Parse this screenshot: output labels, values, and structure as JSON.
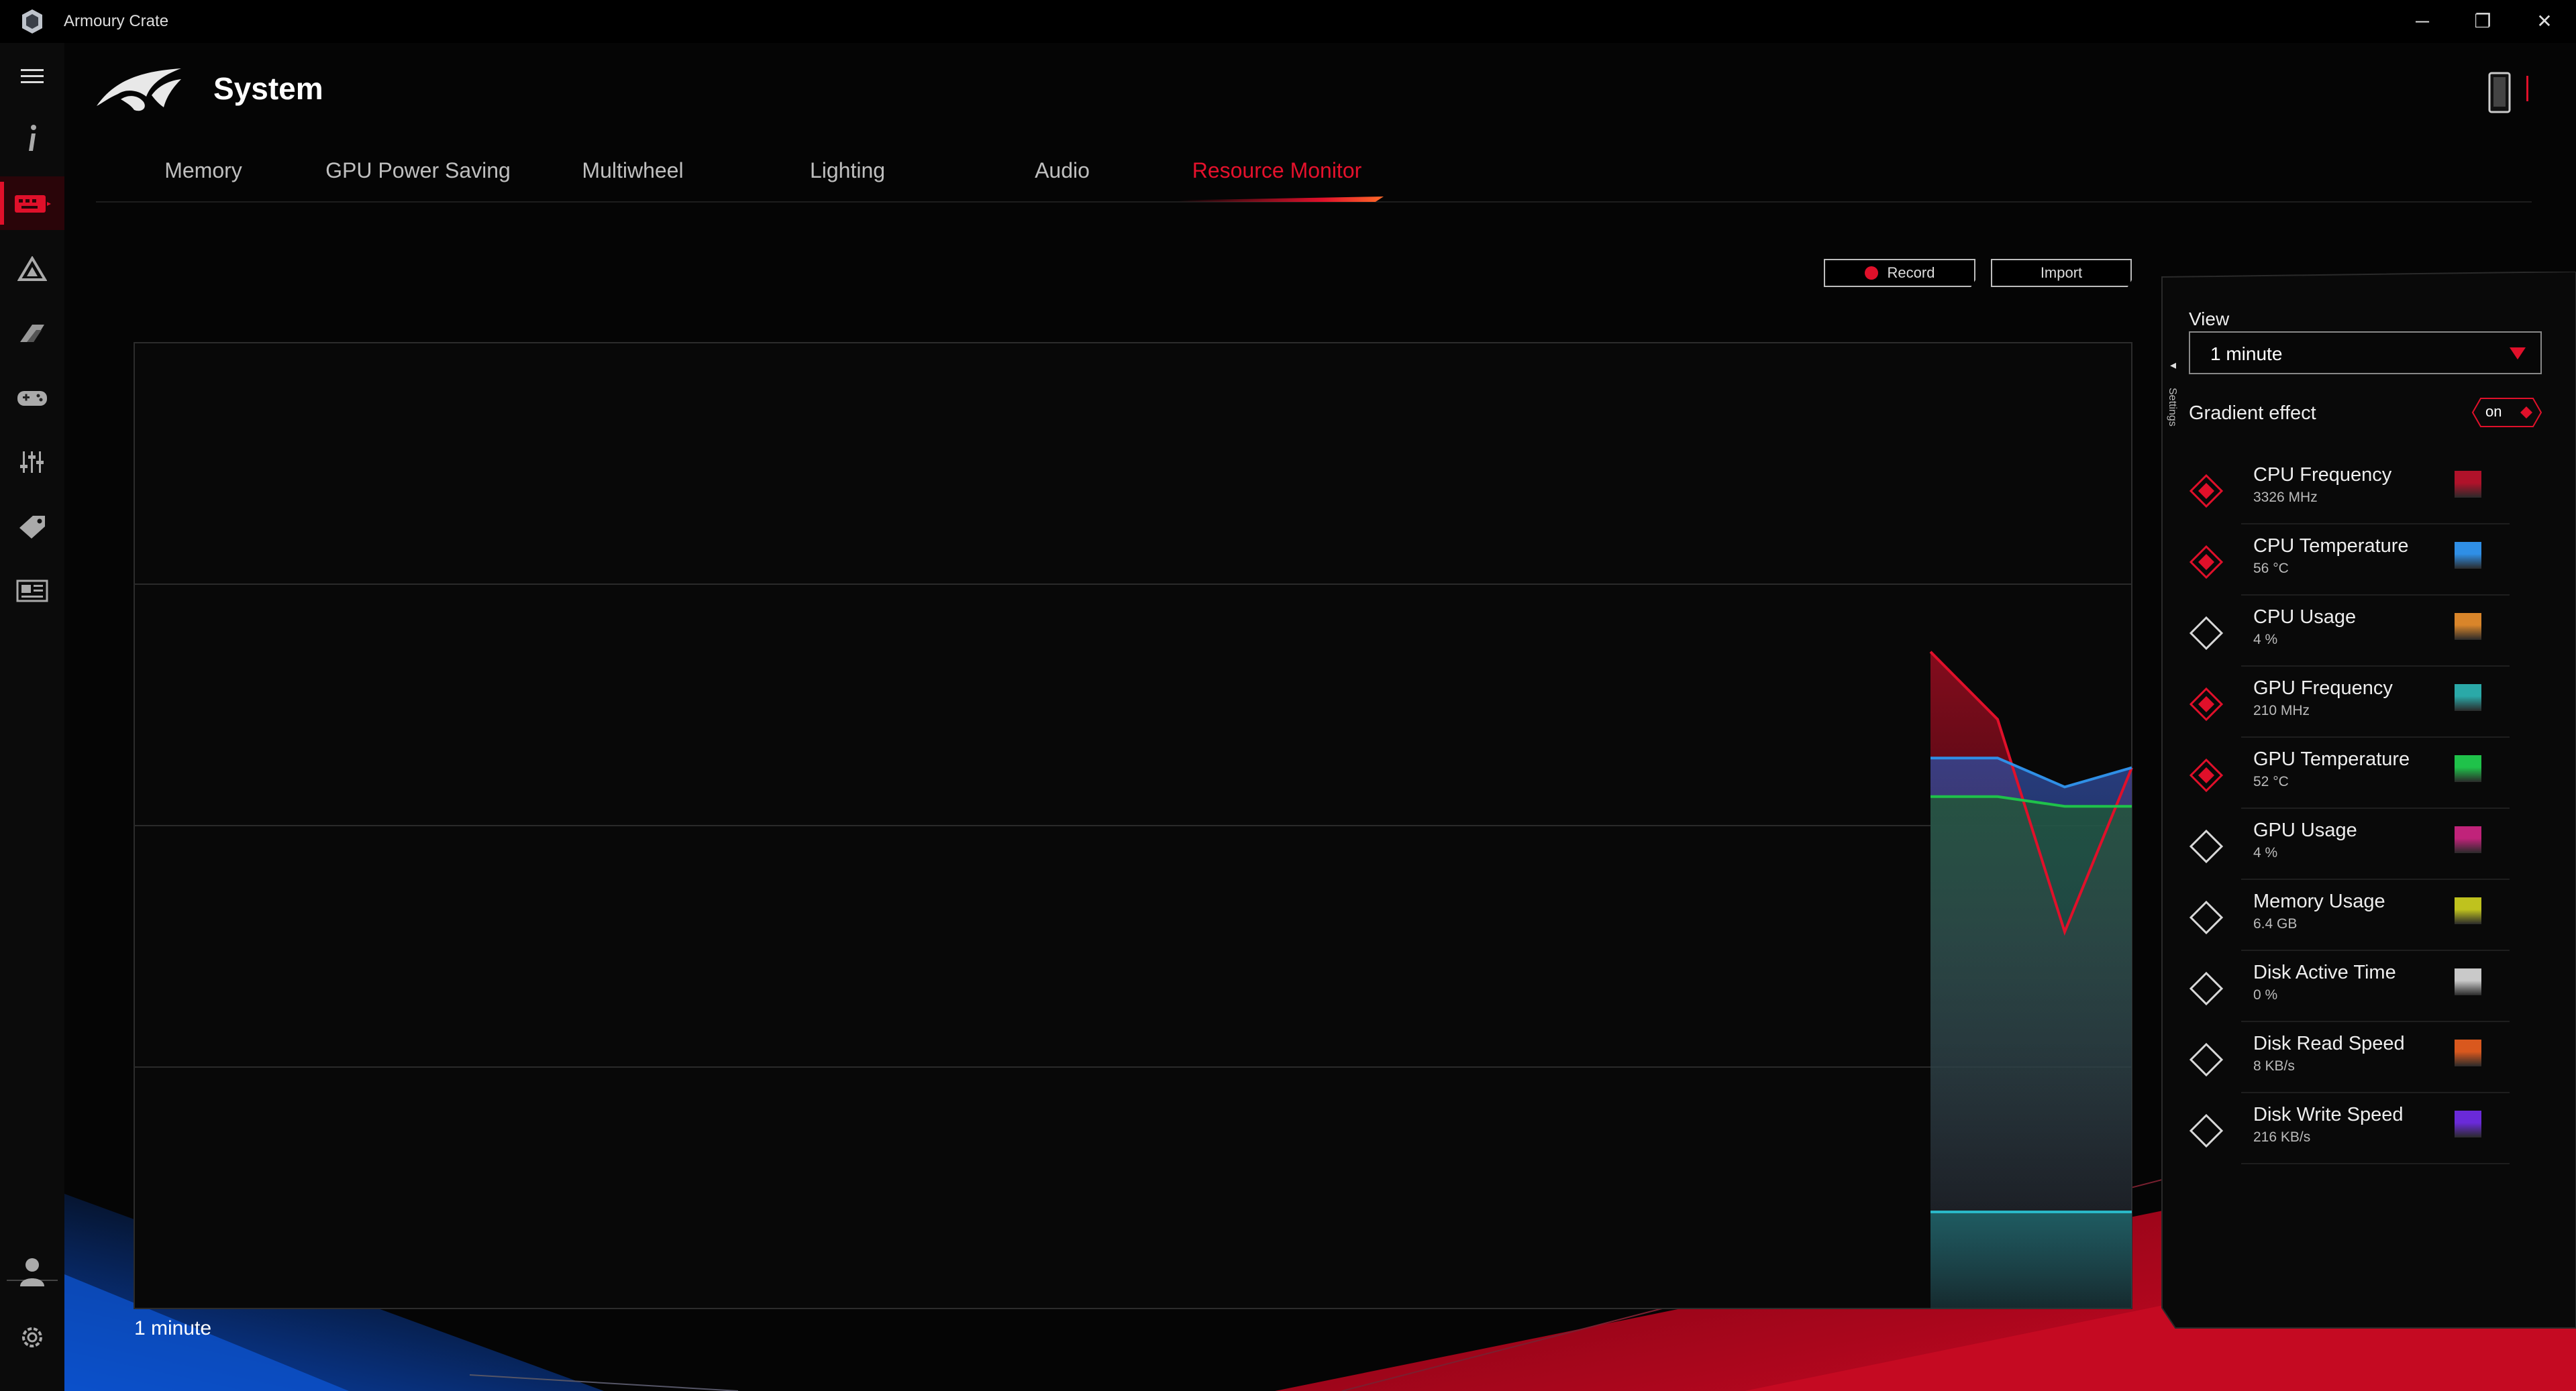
{
  "window": {
    "title": "Armoury Crate",
    "minimize": "─",
    "maximize": "❐",
    "close": "✕"
  },
  "page": {
    "title": "System"
  },
  "tabs": [
    {
      "label": "Memory",
      "active": false
    },
    {
      "label": "GPU Power Saving",
      "active": false
    },
    {
      "label": "Multiwheel",
      "active": false
    },
    {
      "label": "Lighting",
      "active": false
    },
    {
      "label": "Audio",
      "active": false
    },
    {
      "label": "Resource Monitor",
      "active": true
    }
  ],
  "toolbar": {
    "record_label": "Record",
    "import_label": "Import"
  },
  "chart": {
    "range_label": "1 minute"
  },
  "settings": {
    "tab_label": "Settings",
    "view_label": "View",
    "view_value": "1  minute",
    "gradient_label": "Gradient effect",
    "gradient_state": "on"
  },
  "metrics": [
    {
      "name": "CPU Frequency",
      "value": "3326 MHz",
      "checked": true,
      "color": "#b0122a"
    },
    {
      "name": "CPU Temperature",
      "value": "56 °C",
      "checked": true,
      "color": "#2f8fe6"
    },
    {
      "name": "CPU Usage",
      "value": "4 %",
      "checked": false,
      "color": "#d9852a"
    },
    {
      "name": "GPU Frequency",
      "value": "210 MHz",
      "checked": true,
      "color": "#2aa9a8"
    },
    {
      "name": "GPU Temperature",
      "value": "52 °C",
      "checked": true,
      "color": "#1fc24a"
    },
    {
      "name": "GPU Usage",
      "value": "4 %",
      "checked": false,
      "color": "#c0237a"
    },
    {
      "name": "Memory Usage",
      "value": "6.4 GB",
      "checked": false,
      "color": "#bfc21e"
    },
    {
      "name": "Disk Active Time",
      "value": "0 %",
      "checked": false,
      "color": "#c9c9c9"
    },
    {
      "name": "Disk Read Speed",
      "value": "8 KB/s",
      "checked": false,
      "color": "#d9581e"
    },
    {
      "name": "Disk Write Speed",
      "value": "216 KB/s",
      "checked": false,
      "color": "#6a2ad9"
    }
  ],
  "chart_data": {
    "type": "area",
    "x": [
      0,
      1,
      2,
      3
    ],
    "series": [
      {
        "name": "CPU Frequency",
        "values": [
          68,
          61,
          39,
          56
        ],
        "color": "#e0102a"
      },
      {
        "name": "CPU Temperature",
        "values": [
          57,
          57,
          54,
          56
        ],
        "color": "#2f8fe6"
      },
      {
        "name": "GPU Temperature",
        "values": [
          53,
          53,
          52,
          52
        ],
        "color": "#1fc24a"
      },
      {
        "name": "GPU Frequency",
        "values": [
          10,
          10,
          10,
          10
        ],
        "color": "#2ab8c8"
      }
    ],
    "ylim": [
      0,
      100
    ],
    "grid": true
  }
}
